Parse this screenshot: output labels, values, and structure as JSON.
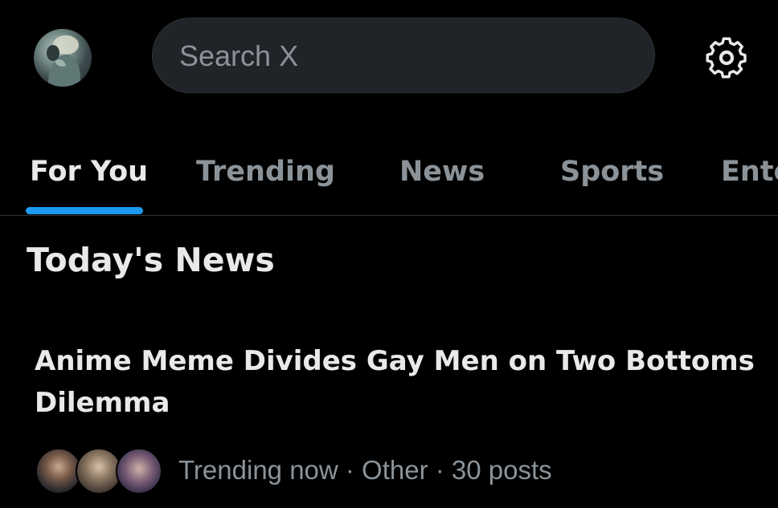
{
  "header": {
    "avatar_icon": "profile-avatar",
    "search_placeholder": "Search X",
    "settings_icon": "gear-icon"
  },
  "tabs": [
    {
      "label": "For You",
      "active": true
    },
    {
      "label": "Trending",
      "active": false
    },
    {
      "label": "News",
      "active": false
    },
    {
      "label": "Sports",
      "active": false
    },
    {
      "label": "Ente",
      "active": false
    }
  ],
  "section": {
    "title": "Today's News"
  },
  "news": [
    {
      "headline": "Anime Meme Divides Gay Men on Two Bottoms Dilemma",
      "meta": "Trending now · Other · 30 posts"
    }
  ],
  "colors": {
    "background": "#000000",
    "text_primary": "#e7e9ea",
    "text_secondary": "#8b9399",
    "accent": "#1d9bf0",
    "search_bg": "#202327",
    "divider": "#2f3336"
  }
}
